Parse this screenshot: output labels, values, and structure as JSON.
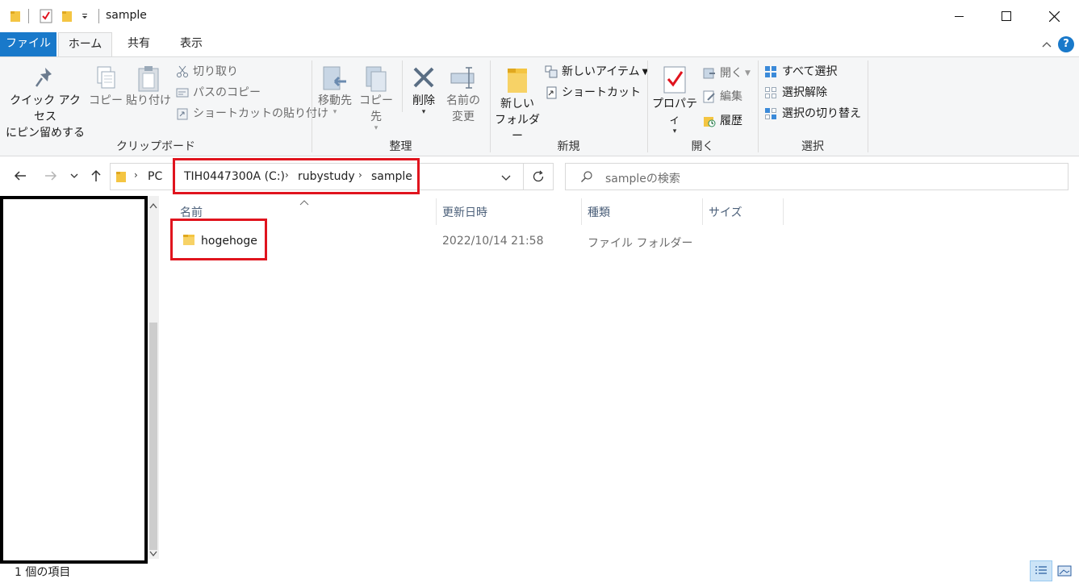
{
  "window": {
    "title": "sample",
    "quick_access": [
      "folder-icon",
      "properties-check-icon",
      "new-folder-icon",
      "customize-dropdown-icon"
    ],
    "controls": {
      "minimize": "minimize-icon",
      "maximize": "maximize-icon",
      "close": "close-icon"
    }
  },
  "tabs": [
    {
      "label": "ファイル"
    },
    {
      "label": "ホーム"
    },
    {
      "label": "共有"
    },
    {
      "label": "表示"
    }
  ],
  "ribbon": {
    "groups": {
      "clipboard": {
        "label": "クリップボード",
        "pin_line1": "クイック アクセス",
        "pin_line2": "にピン留めする",
        "copy": "コピー",
        "paste": "貼り付け",
        "cut": "切り取り",
        "copy_path": "パスのコピー",
        "paste_shortcut": "ショートカットの貼り付け"
      },
      "organize": {
        "label": "整理",
        "move_to": "移動先",
        "copy_to": "コピー先",
        "delete": "削除",
        "rename_line1": "名前の",
        "rename_line2": "変更"
      },
      "new": {
        "label": "新規",
        "new_folder_line1": "新しい",
        "new_folder_line2": "フォルダー",
        "new_item": "新しいアイテム",
        "shortcut": "ショートカット"
      },
      "open": {
        "label": "開く",
        "properties": "プロパティ",
        "open": "開く",
        "edit": "編集",
        "history": "履歴"
      },
      "select": {
        "label": "選択",
        "select_all": "すべて選択",
        "select_none": "選択解除",
        "invert": "選択の切り替え"
      }
    }
  },
  "address": {
    "crumbs": [
      "PC",
      "TIH0447300A (C:)",
      "rubystudy",
      "sample"
    ],
    "search_placeholder": "sampleの検索"
  },
  "columns": [
    "名前",
    "更新日時",
    "種類",
    "サイズ"
  ],
  "files": [
    {
      "name": "hogehoge",
      "modified": "2022/10/14 21:58",
      "type": "ファイル フォルダー",
      "size": ""
    }
  ],
  "status": {
    "item_count": "1 個の項目"
  },
  "colors": {
    "file_tab": "#1979ca",
    "highlight": "#e0141e",
    "folder": "#f4c542"
  }
}
